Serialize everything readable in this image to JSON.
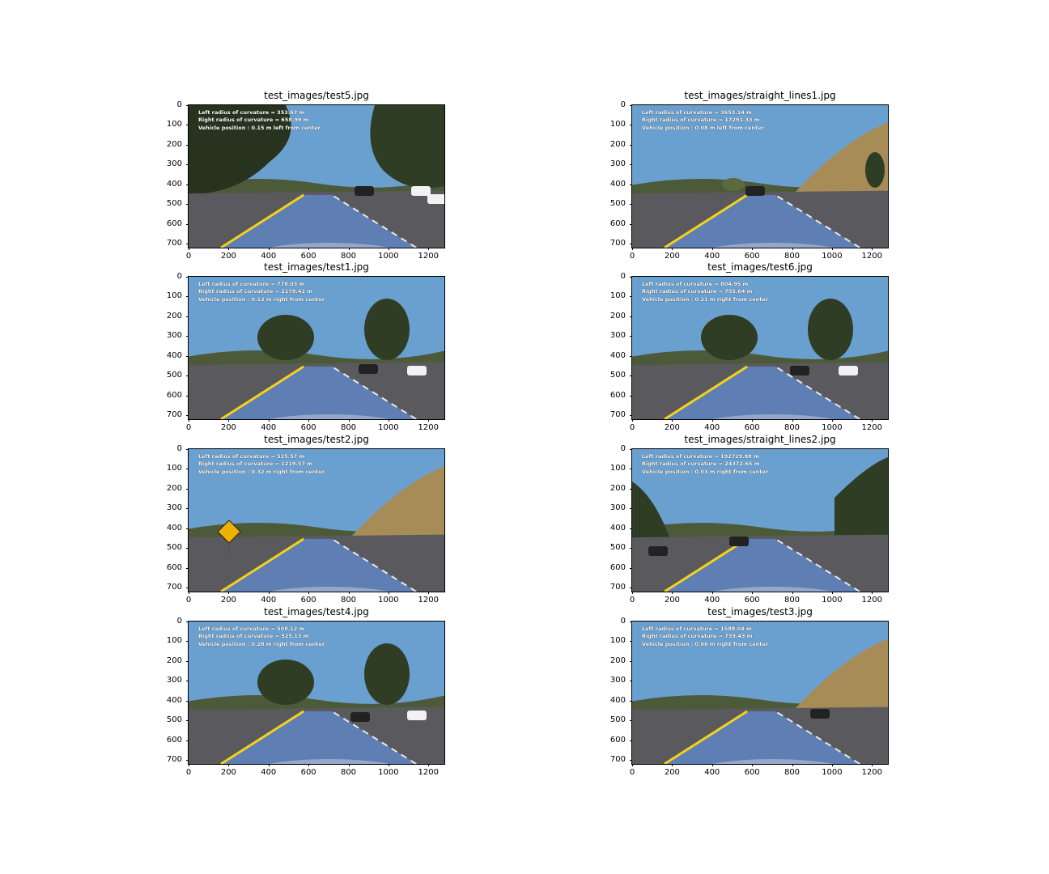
{
  "axis": {
    "y_ticks": [
      "0",
      "100",
      "200",
      "300",
      "400",
      "500",
      "600",
      "700"
    ],
    "x_ticks": [
      "0",
      "200",
      "400",
      "600",
      "800",
      "1000",
      "1200"
    ]
  },
  "colors": {
    "lane_fill": "#5f82bc",
    "lane_yellow": "#f2d21b",
    "sky": "#6aa0d0"
  },
  "panels": [
    {
      "title": "test_images/test5.jpg",
      "l1": "Left radius of curvature  = 353.67 m",
      "l2": "Right radius of curvature = 658.99 m",
      "l3": "Vehicle position : 0.15 m left from center"
    },
    {
      "title": "test_images/straight_lines1.jpg",
      "l1": "Left radius of curvature  = 3653.14 m",
      "l2": "Right radius of curvature = 17291.33 m",
      "l3": "Vehicle position : 0.08 m left from center"
    },
    {
      "title": "test_images/test1.jpg",
      "l1": "Left radius of curvature  = 778.03 m",
      "l2": "Right radius of curvature = 2179.42 m",
      "l3": "Vehicle position : 0.13 m right from center"
    },
    {
      "title": "test_images/test6.jpg",
      "l1": "Left radius of curvature  = 804.95 m",
      "l2": "Right radius of curvature = 755.64 m",
      "l3": "Vehicle position : 0.21 m right from center"
    },
    {
      "title": "test_images/test2.jpg",
      "l1": "Left radius of curvature  = 525.57 m",
      "l2": "Right radius of curvature = 1219.57 m",
      "l3": "Vehicle position : 0.32 m right from center"
    },
    {
      "title": "test_images/straight_lines2.jpg",
      "l1": "Left radius of curvature  = 192729.88 m",
      "l2": "Right radius of curvature = 24372.65 m",
      "l3": "Vehicle position : 0.03 m right from center"
    },
    {
      "title": "test_images/test4.jpg",
      "l1": "Left radius of curvature  = 508.12 m",
      "l2": "Right radius of curvature = 525.13 m",
      "l3": "Vehicle position : 0.28 m right from center"
    },
    {
      "title": "test_images/test3.jpg",
      "l1": "Left radius of curvature  = 1588.04 m",
      "l2": "Right radius of curvature = 759.43 m",
      "l3": "Vehicle position : 0.08 m right from center"
    }
  ]
}
